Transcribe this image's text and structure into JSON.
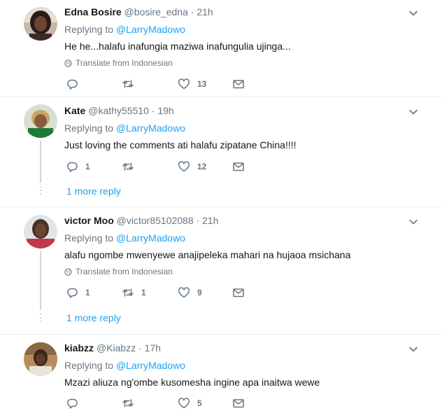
{
  "tweets": [
    {
      "name": "Edna Bosire",
      "handle": "@bosire_edna",
      "dot": "·",
      "time": "21h",
      "replying_prefix": "Replying to",
      "replying_to": "@LarryMadowo",
      "text": "He he...halafu inafungia maziwa inafungulia ujinga...",
      "translate": "Translate from Indonesian",
      "reply_count": "",
      "retweet_count": "",
      "like_count": "13"
    },
    {
      "name": "Kate",
      "handle": "@kathy55510",
      "dot": "·",
      "time": "19h",
      "replying_prefix": "Replying to",
      "replying_to": "@LarryMadowo",
      "text": "Just loving the comments ati halafu zipatane China!!!!",
      "reply_count": "1",
      "retweet_count": "",
      "like_count": "12",
      "more_reply": "1 more reply"
    },
    {
      "name": "victor Moo",
      "handle": "@victor85102088",
      "dot": "·",
      "time": "21h",
      "replying_prefix": "Replying to",
      "replying_to": "@LarryMadowo",
      "text": "alafu ngombe mwenyewe anajipeleka mahari na hujaoa msichana",
      "translate": "Translate from Indonesian",
      "reply_count": "1",
      "retweet_count": "1",
      "like_count": "9",
      "more_reply": "1 more reply"
    },
    {
      "name": "kiabzz",
      "handle": "@Kiabzz",
      "dot": "·",
      "time": "17h",
      "replying_prefix": "Replying to",
      "replying_to": "@LarryMadowo",
      "text": "Mzazi aliuza ng'ombe kusomesha ingine apa inaitwa wewe",
      "reply_count": "",
      "retweet_count": "",
      "like_count": "5"
    }
  ],
  "icons": {
    "reply": "reply-icon",
    "retweet": "retweet-icon",
    "like": "heart-icon",
    "dm": "envelope-icon",
    "more": "chevron-down-icon",
    "globe": "globe-icon"
  },
  "colors": {
    "link": "#1da1f2",
    "secondary": "#657786",
    "divider": "#e6ecf0",
    "thread": "#ccd6dd"
  }
}
